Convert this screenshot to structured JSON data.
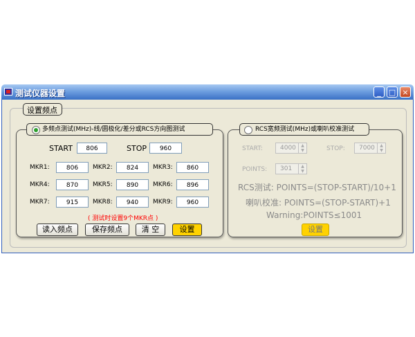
{
  "window": {
    "title": "测试仪器设置"
  },
  "titlebar_buttons": {
    "minimize": "_",
    "maximize": "□",
    "close": "×"
  },
  "group_title": "设置频点",
  "left_panel": {
    "radio_label": "多频点测试(MHz)-线/圆极化/差分或RCS方向图测试",
    "start_label": "START",
    "start_value": "806",
    "stop_label": "STOP",
    "stop_value": "960",
    "markers": [
      {
        "label": "MKR1:",
        "value": "806"
      },
      {
        "label": "MKR2:",
        "value": "824"
      },
      {
        "label": "MKR3:",
        "value": "860"
      },
      {
        "label": "MKR4:",
        "value": "870"
      },
      {
        "label": "MKR5:",
        "value": "890"
      },
      {
        "label": "MKR6:",
        "value": "896"
      },
      {
        "label": "MKR7:",
        "value": "915"
      },
      {
        "label": "MKR8:",
        "value": "940"
      },
      {
        "label": "MKR9:",
        "value": "960"
      }
    ],
    "warning": "( 测试时设置9个MKR点 )",
    "buttons": {
      "read": "读入频点",
      "save": "保存频点",
      "clear": "清 空",
      "set": "设置"
    }
  },
  "right_panel": {
    "radio_label": "RCS宽频测试(MHz)或喇叭校准测试",
    "start_label": "START:",
    "start_value": "4000",
    "stop_label": "STOP:",
    "stop_value": "7000",
    "points_label": "POINTS:",
    "points_value": "301",
    "formula_rcs": "RCS测试: POINTS=(STOP-START)/10+1",
    "formula_horn": "喇叭校准: POINTS=(STOP-START)+1",
    "formula_warning": "Warning:POINTS≤1001",
    "set_button": "设置"
  },
  "colors": {
    "accent_button": "#ffd200",
    "warning_text": "#ff0000",
    "window_bg": "#ece9d8"
  }
}
